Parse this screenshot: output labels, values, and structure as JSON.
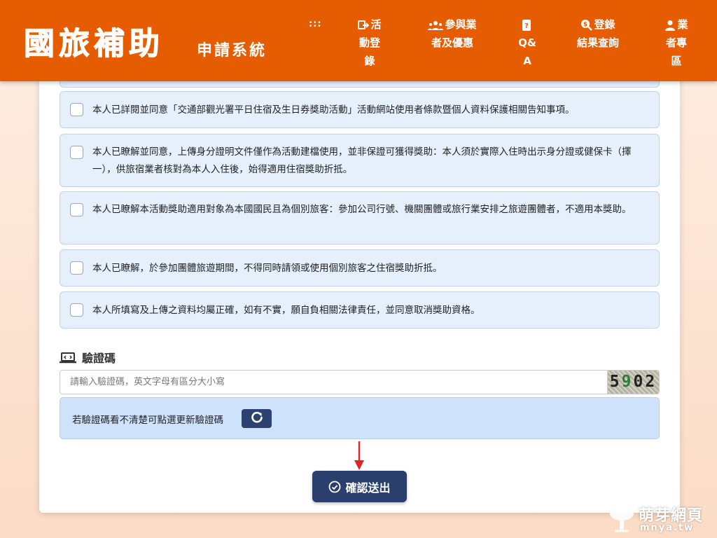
{
  "header": {
    "logo_main": "國旅補助",
    "logo_sub": "申請系統",
    "menu_glyph": ":::",
    "nav": {
      "activity_login": [
        "活",
        "動登",
        "錄"
      ],
      "participating": [
        "參與業",
        "者及優惠"
      ],
      "qa": [
        "Q&",
        "A"
      ],
      "result_query": [
        "登錄",
        "結果查詢"
      ],
      "vendor": [
        "業",
        "者專",
        "區"
      ]
    }
  },
  "agreements": [
    {
      "text": "本人已詳閱並同意「交通部觀光署平日住宿及生日券獎助活動」活動網站使用者條款暨個人資料保護相關告知事項。"
    },
    {
      "text": "本人已瞭解並同意，上傳身分證明文件僅作為活動建檔使用，並非保證可獲得獎助：本人須於實際入住時出示身分證或健保卡（擇一），供旅宿業者核對為本人入住後，始得適用住宿獎助折抵。"
    },
    {
      "text": "本人已瞭解本活動獎助適用對象為本國國民且為個別旅客：參加公司行號、機關團體或旅行業安排之旅遊團體者，不適用本獎助。"
    },
    {
      "text": "本人已瞭解，於參加團體旅遊期間，不得同時請領或使用個別旅客之住宿獎助折抵。"
    },
    {
      "text": "本人所填寫及上傳之資料均屬正確，如有不實，願自負相關法律責任，並同意取消獎助資格。"
    }
  ],
  "captcha": {
    "title": "驗證碼",
    "placeholder": "請輸入驗證碼，英文字母有區分大小寫",
    "value": "",
    "image_digits": [
      "5",
      "9",
      "0",
      "2"
    ],
    "refresh_hint": "若驗證碼看不清楚可點選更新驗證碼"
  },
  "submit": {
    "label": "確認送出"
  },
  "watermark": {
    "cn": "萌芽網頁",
    "en": "mnya.tw"
  },
  "colors": {
    "header": "#e65c00",
    "agree_bg": "#e6f0fd",
    "refresh_bg": "#cfe2fb",
    "button": "#2a3f6b",
    "arrow": "#d9262b"
  }
}
